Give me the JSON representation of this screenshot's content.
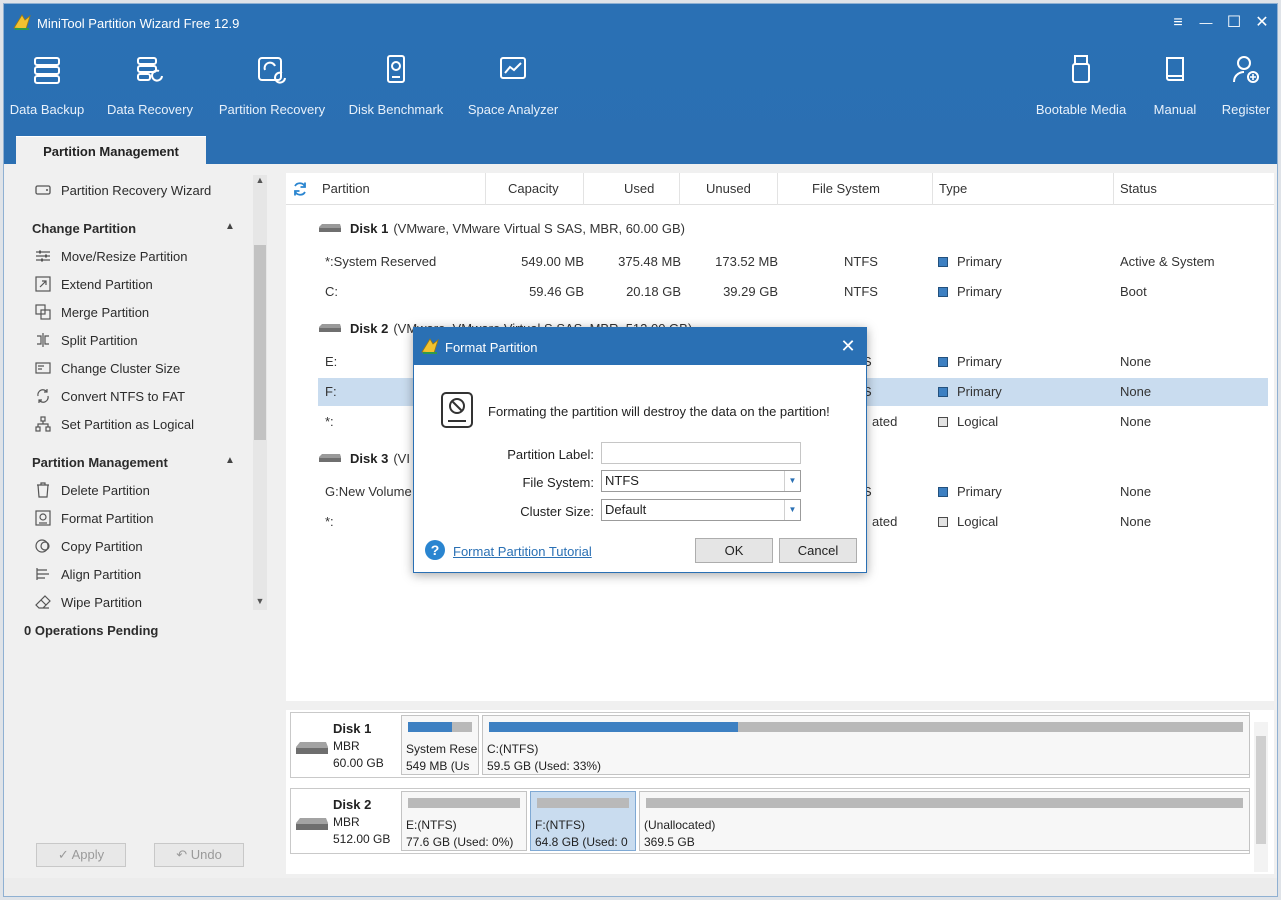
{
  "app": {
    "title": "MiniTool Partition Wizard Free 12.9",
    "accent": "#2a70b4"
  },
  "window_controls": {
    "menu": "≡",
    "minimize": "—",
    "maximize": "☐",
    "close": "✕"
  },
  "toolbar": {
    "data_backup": "Data Backup",
    "data_recovery": "Data Recovery",
    "partition_recovery": "Partition Recovery",
    "disk_benchmark": "Disk Benchmark",
    "space_analyzer": "Space Analyzer",
    "bootable_media": "Bootable Media",
    "manual": "Manual",
    "register": "Register"
  },
  "tab": {
    "active": "Partition Management"
  },
  "sidebar": {
    "partition_recovery_wizard": "Partition Recovery Wizard",
    "change_partition": {
      "title": "Change Partition",
      "items": [
        "Move/Resize Partition",
        "Extend Partition",
        "Merge Partition",
        "Split Partition",
        "Change Cluster Size",
        "Convert NTFS to FAT",
        "Set Partition as Logical"
      ]
    },
    "partition_management": {
      "title": "Partition Management",
      "items": [
        "Delete Partition",
        "Format Partition",
        "Copy Partition",
        "Align Partition",
        "Wipe Partition"
      ]
    },
    "operations_pending": "0 Operations Pending",
    "apply": "Apply",
    "undo": "Undo"
  },
  "table": {
    "columns": [
      "Partition",
      "Capacity",
      "Used",
      "Unused",
      "File System",
      "Type",
      "Status"
    ],
    "disks": [
      {
        "name": "Disk 1",
        "info": "(VMware, VMware Virtual S SAS, MBR, 60.00 GB)",
        "partitions": [
          {
            "partition": "*:System Reserved",
            "capacity": "549.00 MB",
            "used": "375.48 MB",
            "unused": "173.52 MB",
            "fs": "NTFS",
            "type": "Primary",
            "status": "Active & System"
          },
          {
            "partition": "C:",
            "capacity": "59.46 GB",
            "used": "20.18 GB",
            "unused": "39.29 GB",
            "fs": "NTFS",
            "type": "Primary",
            "status": "Boot"
          }
        ]
      },
      {
        "name": "Disk 2",
        "info": "(VMware, VMware Virtual S SAS, MBR, 512.00 GB)",
        "partitions": [
          {
            "partition": "E:",
            "fs": "S",
            "type": "Primary",
            "status": "None"
          },
          {
            "partition": "F:",
            "fs": "S",
            "type": "Primary",
            "status": "None"
          },
          {
            "partition": "*:",
            "fs": "ated",
            "type": "Logical",
            "status": "None"
          }
        ]
      },
      {
        "name": "Disk 3",
        "info": "(VI",
        "partitions": [
          {
            "partition": "G:New Volume",
            "fs": "S",
            "type": "Primary",
            "status": "None"
          },
          {
            "partition": "*:",
            "fs": "ated",
            "type": "Logical",
            "status": "None"
          }
        ]
      }
    ]
  },
  "disk_map": [
    {
      "name": "Disk 1",
      "scheme": "MBR",
      "size": "60.00 GB",
      "parts": [
        {
          "l1": "System Rese",
          "l2": "549 MB (Us",
          "used_fraction": 0.68
        },
        {
          "l1": "C:(NTFS)",
          "l2": "59.5 GB (Used: 33%)",
          "used_fraction": 0.33
        }
      ]
    },
    {
      "name": "Disk 2",
      "scheme": "MBR",
      "size": "512.00 GB",
      "parts": [
        {
          "l1": "E:(NTFS)",
          "l2": "77.6 GB (Used: 0%)",
          "used_fraction": 0
        },
        {
          "l1": "F:(NTFS)",
          "l2": "64.8 GB (Used: 0",
          "used_fraction": 0
        },
        {
          "l1": "(Unallocated)",
          "l2": "369.5 GB",
          "used_fraction": 0
        }
      ]
    }
  ],
  "dialog": {
    "title": "Format Partition",
    "message": "Formating the partition will destroy the data on the partition!",
    "partition_label": {
      "label": "Partition Label:",
      "value": ""
    },
    "file_system": {
      "label": "File System:",
      "value": "NTFS"
    },
    "cluster_size": {
      "label": "Cluster Size:",
      "value": "Default"
    },
    "help_icon": "?",
    "tutorial_link": "Format Partition Tutorial",
    "ok": "OK",
    "cancel": "Cancel"
  }
}
